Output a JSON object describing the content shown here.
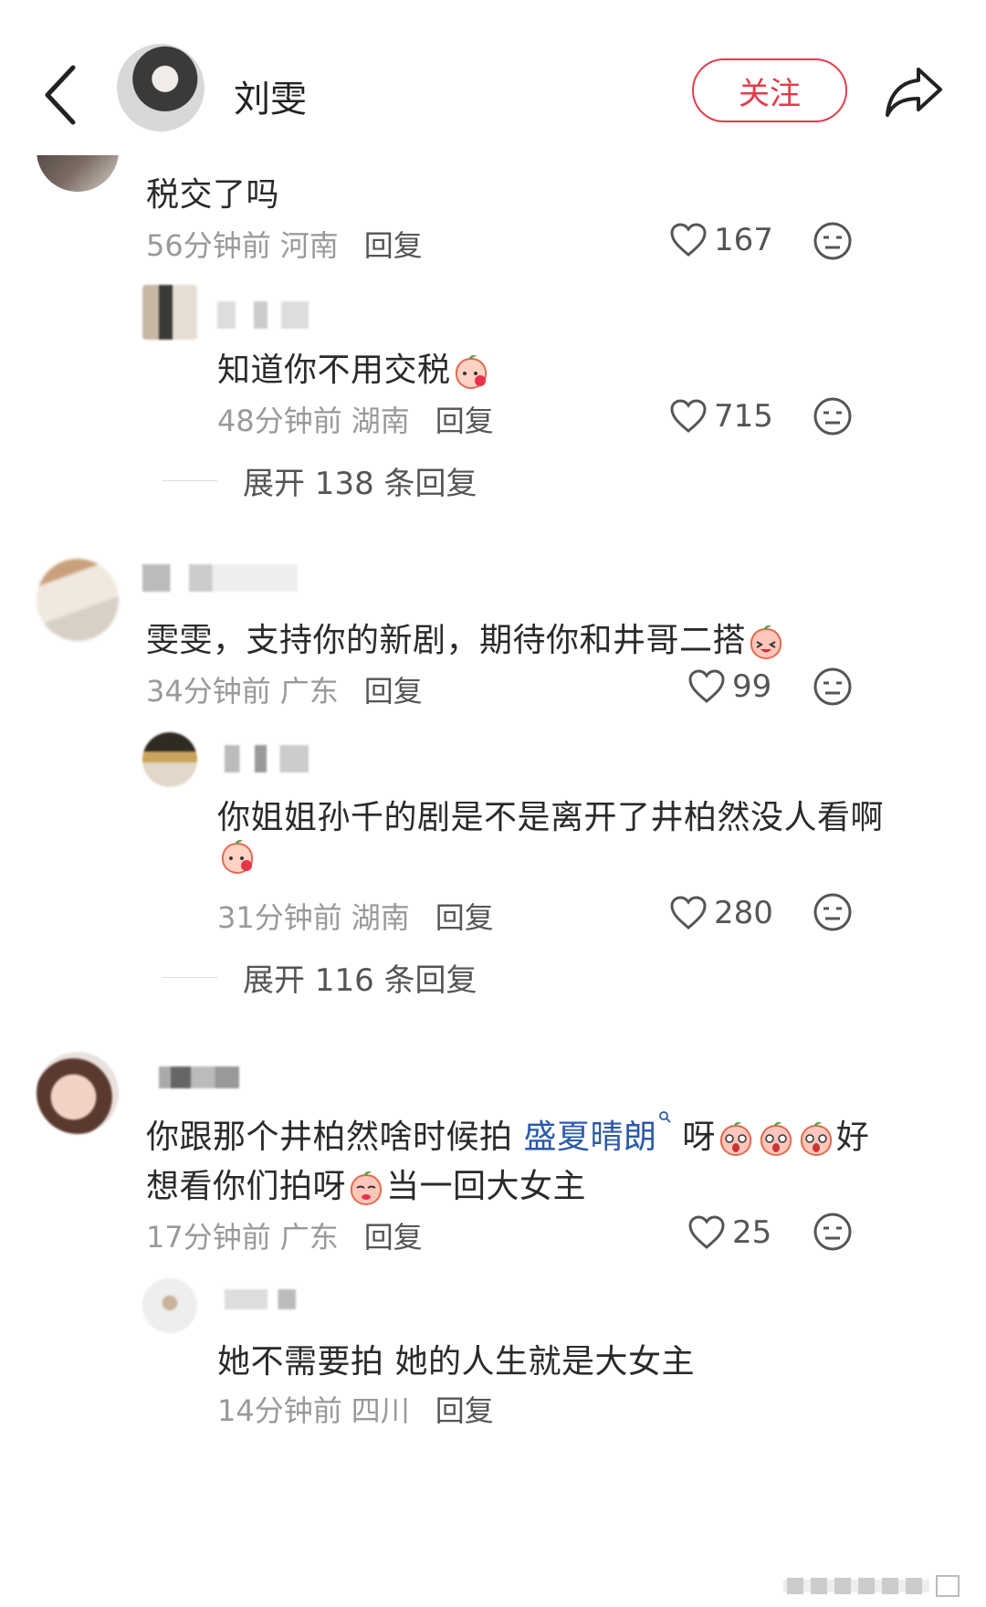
{
  "header": {
    "author_name": "刘雯",
    "follow_label": "关注"
  },
  "comments": [
    {
      "text": "税交了吗",
      "time": "56分钟前",
      "location": "河南",
      "reply_label": "回复",
      "likes": "167",
      "replies": [
        {
          "text": "知道你不用交税",
          "time": "48分钟前",
          "location": "湖南",
          "reply_label": "回复",
          "likes": "715"
        }
      ],
      "expand_label": "展开 138 条回复"
    },
    {
      "text": "雯雯，支持你的新剧，期待你和井哥二搭",
      "time": "34分钟前",
      "location": "广东",
      "reply_label": "回复",
      "likes": "99",
      "replies": [
        {
          "text": "你姐姐孙千的剧是不是离开了井柏然没人看啊",
          "time": "31分钟前",
          "location": "湖南",
          "reply_label": "回复",
          "likes": "280"
        }
      ],
      "expand_label": "展开 116 条回复"
    },
    {
      "text_part1": "你跟那个井柏然啥时候拍 ",
      "link_text": "盛夏晴朗",
      "text_part2": " 呀",
      "text_part3": "好",
      "text_line2_a": "想看你们拍呀",
      "text_line2_b": "当一回大女主",
      "time": "17分钟前",
      "location": "广东",
      "reply_label": "回复",
      "likes": "25",
      "replies": [
        {
          "text": "她不需要拍 她的人生就是大女主",
          "time": "14分钟前",
          "location": "四川",
          "reply_label": "回复"
        }
      ]
    }
  ],
  "colors": {
    "accent": "#e33b4b",
    "link": "#2b5aa8",
    "meta": "#999999"
  },
  "icons": [
    "back-arrow-icon",
    "share-icon",
    "heart-icon",
    "emoji-icon",
    "search-icon"
  ]
}
